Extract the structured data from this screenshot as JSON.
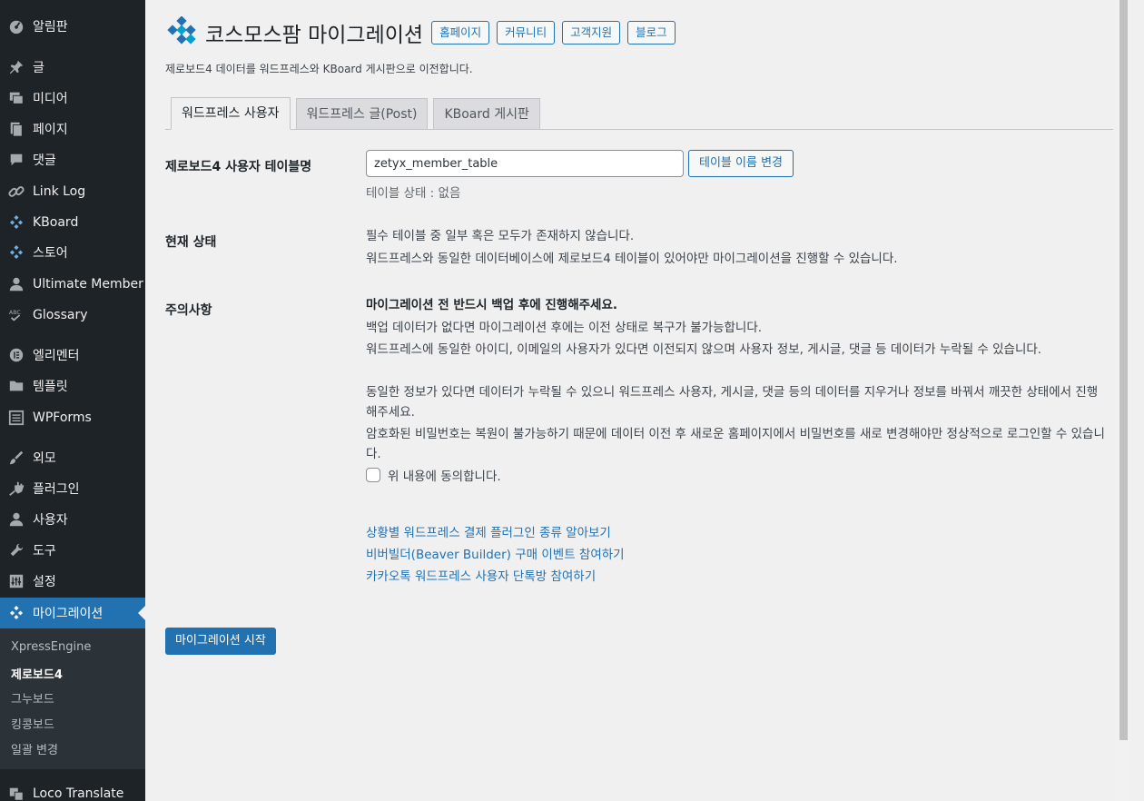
{
  "sidebar": {
    "items": [
      {
        "label": "알림판",
        "icon": "dashboard-icon"
      },
      {
        "label": "글",
        "icon": "pin-icon"
      },
      {
        "label": "미디어",
        "icon": "media-icon"
      },
      {
        "label": "페이지",
        "icon": "page-icon"
      },
      {
        "label": "댓글",
        "icon": "comment-icon"
      },
      {
        "label": "Link Log",
        "icon": "link-icon"
      },
      {
        "label": "KBoard",
        "icon": "kboard-icon"
      },
      {
        "label": "스토어",
        "icon": "store-icon"
      },
      {
        "label": "Ultimate Member",
        "icon": "user-icon"
      },
      {
        "label": "Glossary",
        "icon": "glossary-icon"
      },
      {
        "label": "엘리멘터",
        "icon": "elementor-icon"
      },
      {
        "label": "템플릿",
        "icon": "folder-icon"
      },
      {
        "label": "WPForms",
        "icon": "forms-icon"
      },
      {
        "label": "외모",
        "icon": "brush-icon"
      },
      {
        "label": "플러그인",
        "icon": "plugin-icon"
      },
      {
        "label": "사용자",
        "icon": "user-icon"
      },
      {
        "label": "도구",
        "icon": "wrench-icon"
      },
      {
        "label": "설정",
        "icon": "settings-icon"
      },
      {
        "label": "마이그레이션",
        "icon": "migration-icon"
      },
      {
        "label": "Loco Translate",
        "icon": "translate-icon"
      }
    ],
    "submenu": [
      "XpressEngine",
      "제로보드4",
      "그누보드",
      "킹콩보드",
      "일괄 변경"
    ]
  },
  "header": {
    "title": "코스모스팜 마이그레이션",
    "buttons": [
      "홈페이지",
      "커뮤니티",
      "고객지원",
      "블로그"
    ],
    "description": "제로보드4 데이터를 워드프레스와 KBoard 게시판으로 이전합니다."
  },
  "tabs": [
    "워드프레스 사용자",
    "워드프레스 글(Post)",
    "KBoard 게시판"
  ],
  "form": {
    "table_label": "제로보드4 사용자 테이블명",
    "table_value": "zetyx_member_table",
    "rename_button": "테이블 이름 변경",
    "table_status": "테이블 상태 : 없음",
    "status_label": "현재 상태",
    "status_lines": [
      "필수 테이블 중 일부 혹은 모두가 존재하지 않습니다.",
      "워드프레스와 동일한 데이터베이스에 제로보드4 테이블이 있어야만 마이그레이션을 진행할 수 있습니다."
    ],
    "notice_label": "주의사항",
    "notice_title": "마이그레이션 전 반드시 백업 후에 진행해주세요.",
    "notice_lines": [
      "백업 데이터가 없다면 마이그레이션 후에는 이전 상태로 복구가 불가능합니다.",
      "워드프레스에 동일한 아이디, 이메일의 사용자가 있다면 이전되지 않으며 사용자 정보, 게시글, 댓글 등 데이터가 누락될 수 있습니다.",
      "동일한 정보가 있다면 데이터가 누락될 수 있으니 워드프레스 사용자, 게시글, 댓글 등의 데이터를 지우거나 정보를 바꿔서 깨끗한 상태에서 진행해주세요.",
      "암호화된 비밀번호는 복원이 불가능하기 때문에 데이터 이전 후 새로운 홈페이지에서 비밀번호를 새로 변경해야만 정상적으로 로그인할 수 있습니다."
    ],
    "agree_label": "위 내용에 동의합니다."
  },
  "links": [
    "상황별 워드프레스 결제 플러그인 종류 알아보기",
    "비버빌더(Beaver Builder) 구매 이벤트 참여하기",
    "카카오톡 워드프레스 사용자 단톡방 참여하기"
  ],
  "start_button": "마이그레이션 시작",
  "colors": {
    "sidebar_bg": "#1d2327",
    "accent": "#2271b1",
    "content_bg": "#f0f0f1"
  }
}
